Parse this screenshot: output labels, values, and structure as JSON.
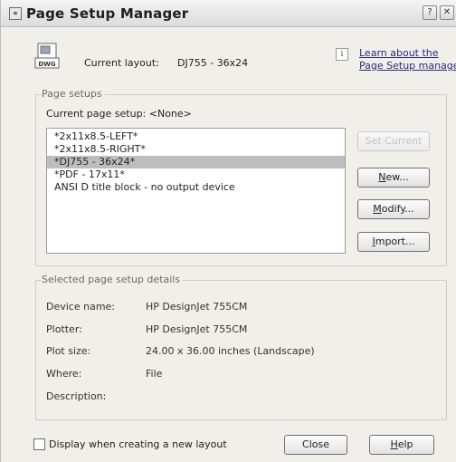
{
  "window": {
    "title": "Page Setup Manager",
    "help_glyph": "?",
    "close_glyph": "✕"
  },
  "current_layout": {
    "icon_label": "DWG",
    "label": "Current layout:",
    "value": "DJ755 - 36x24"
  },
  "learn_link": {
    "line1": "Learn about the",
    "line2": "Page Setup manager"
  },
  "page_setups": {
    "group_label": "Page setups",
    "current_setup_text": "Current page setup:  <None>",
    "items": [
      {
        "label": "*2x11x8.5-LEFT*",
        "selected": false
      },
      {
        "label": "*2x11x8.5-RIGHT*",
        "selected": false
      },
      {
        "label": "*DJ755 - 36x24*",
        "selected": true
      },
      {
        "label": "*PDF - 17x11*",
        "selected": false
      },
      {
        "label": "ANSI D title block - no output device",
        "selected": false
      }
    ],
    "buttons": {
      "set_current": "Set Current",
      "new_pre": "N",
      "new_post": "ew...",
      "modify_pre": "M",
      "modify_post": "odify...",
      "import_pre": "I",
      "import_post": "mport..."
    }
  },
  "details": {
    "group_label": "Selected page setup details",
    "rows": [
      {
        "label": "Device name:",
        "value": "HP DesignJet 755CM"
      },
      {
        "label": "Plotter:",
        "value": "HP DesignJet 755CM"
      },
      {
        "label": "Plot size:",
        "value": "24.00 x 36.00 inches (Landscape)"
      },
      {
        "label": "Where:",
        "value": "File"
      },
      {
        "label": "Description:",
        "value": ""
      }
    ]
  },
  "footer": {
    "checkbox_label": "Display when creating a new layout",
    "checkbox_checked": false,
    "close_label": "Close",
    "help_pre": "H",
    "help_post": "elp"
  }
}
